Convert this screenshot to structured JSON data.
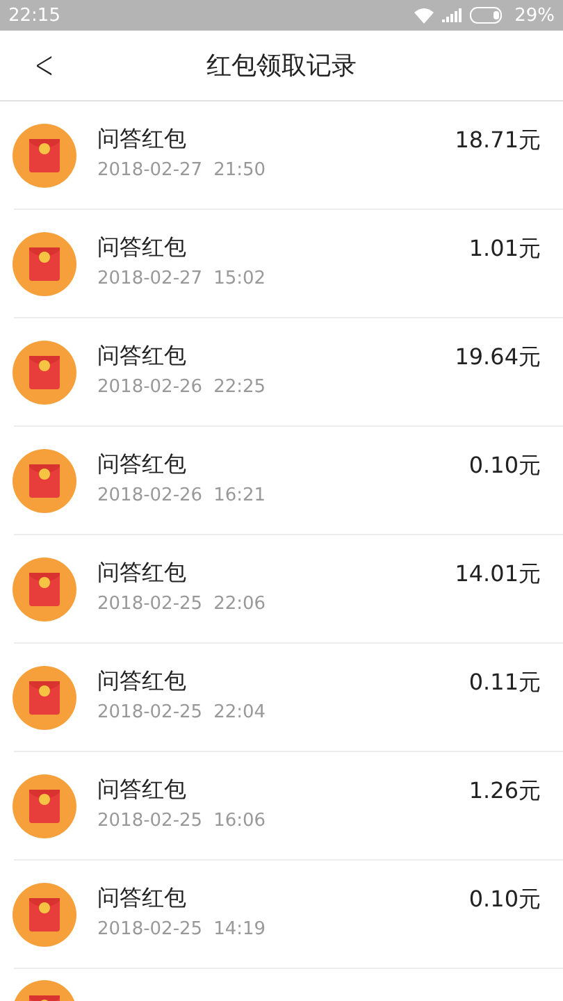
{
  "status_bar": {
    "time": "22:15",
    "battery": "29%"
  },
  "header": {
    "back": "<",
    "title": "红包领取记录"
  },
  "records": [
    {
      "name": "问答红包",
      "date": "2018-02-27",
      "time": "21:50",
      "amount": "18.71元"
    },
    {
      "name": "问答红包",
      "date": "2018-02-27",
      "time": "15:02",
      "amount": "1.01元"
    },
    {
      "name": "问答红包",
      "date": "2018-02-26",
      "time": "22:25",
      "amount": "19.64元"
    },
    {
      "name": "问答红包",
      "date": "2018-02-26",
      "time": "16:21",
      "amount": "0.10元"
    },
    {
      "name": "问答红包",
      "date": "2018-02-25",
      "time": "22:06",
      "amount": "14.01元"
    },
    {
      "name": "问答红包",
      "date": "2018-02-25",
      "time": "22:04",
      "amount": "0.11元"
    },
    {
      "name": "问答红包",
      "date": "2018-02-25",
      "time": "16:06",
      "amount": "1.26元"
    },
    {
      "name": "问答红包",
      "date": "2018-02-25",
      "time": "14:19",
      "amount": "0.10元"
    }
  ]
}
